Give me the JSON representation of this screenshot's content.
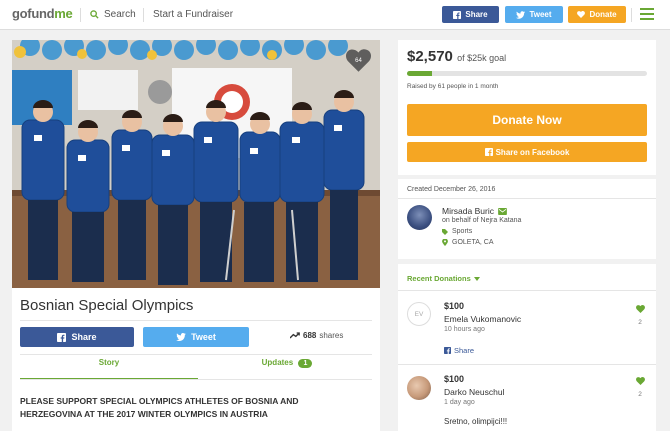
{
  "header": {
    "logo_pre": "go",
    "logo_mid": "fund",
    "logo_post": "me",
    "search_label": "Search",
    "start_label": "Start a Fundraiser",
    "share_label": "Share",
    "tweet_label": "Tweet",
    "donate_label": "Donate"
  },
  "campaign": {
    "photo_hearts": "64",
    "title": "Bosnian Special Olympics",
    "share_label": "Share",
    "tweet_label": "Tweet",
    "shares_count": "688",
    "shares_label": "shares",
    "tabs": {
      "story": "Story",
      "updates": "Updates",
      "updates_count": "1"
    },
    "story_text": "PLEASE SUPPORT SPECIAL OLYMPICS ATHLETES OF BOSNIA AND HERZEGOVINA AT THE 2017 WINTER OLYMPICS IN AUSTRIA"
  },
  "donate": {
    "raised": "$2,570",
    "goal": "of $25k goal",
    "progress_fraction": 0.1028,
    "raised_by": "Raised by 61 people in 1 month",
    "donate_now": "Donate Now",
    "share_facebook": "Share on Facebook"
  },
  "info": {
    "created": "Created December 26, 2016",
    "organizer_name": "Mirsada Buric",
    "on_behalf": "on behalf of Nejra Katana",
    "category": "Sports",
    "location": "GOLETA, CA"
  },
  "recent": {
    "heading": "Recent Donations",
    "donations": [
      {
        "initials": "EV",
        "amount": "$100",
        "name": "Emela Vukomanovic",
        "time": "10 hours ago",
        "hearts": "2",
        "share_label": "Share"
      },
      {
        "amount": "$100",
        "name": "Darko Neuschul",
        "time": "1 day ago",
        "hearts": "2",
        "message": "Sretno, olimpijci!!!"
      }
    ]
  },
  "colors": {
    "brand_green": "#6aa834",
    "facebook_blue": "#3b5998",
    "twitter_blue": "#55acee",
    "donate_orange": "#f5a623"
  },
  "icons": [
    "search-icon",
    "facebook-icon",
    "twitter-icon",
    "trending-icon",
    "heart-icon",
    "verified-mail-icon",
    "tag-icon",
    "location-pin-icon",
    "hamburger-menu-icon",
    "chevron-down-icon"
  ]
}
